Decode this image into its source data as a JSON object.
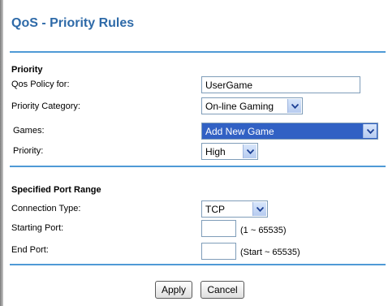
{
  "page_title": "QoS - Priority Rules",
  "priority_section": {
    "heading": "Priority",
    "policy_label": "Qos Policy for:",
    "policy_value": "UserGame",
    "category_label": "Priority Category:",
    "category_value": "On-line Gaming",
    "games_label": "Games:",
    "games_value": "Add New Game",
    "priority_label": "Priority:",
    "priority_value": "High"
  },
  "port_section": {
    "heading": "Specified Port Range",
    "connection_label": "Connection Type:",
    "connection_value": "TCP",
    "start_label": "Starting Port:",
    "start_value": "",
    "start_hint": "(1 ~ 65535)",
    "end_label": "End Port:",
    "end_value": "",
    "end_hint": "(Start ~ 65535)"
  },
  "buttons": {
    "apply": "Apply",
    "cancel": "Cancel"
  },
  "colors": {
    "title": "#2e6aa8",
    "divider": "#4f9ad6",
    "selected_option": "#3161c4"
  }
}
